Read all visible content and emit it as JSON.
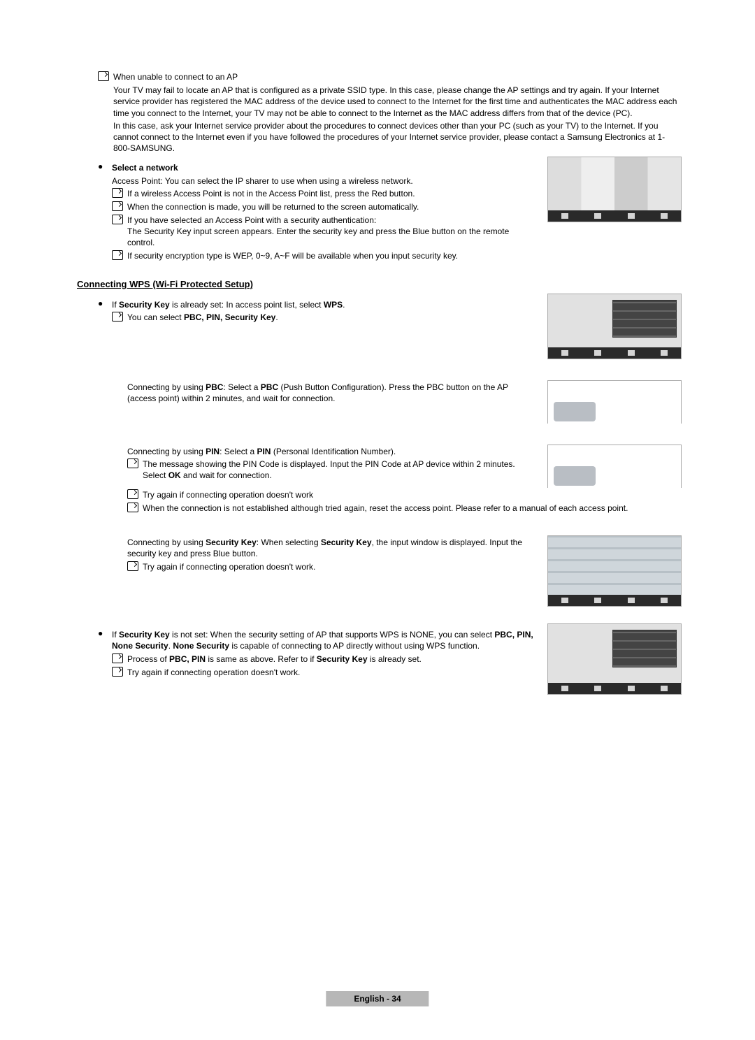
{
  "s1": {
    "n1": "When unable to connect to an AP",
    "p1": "Your TV may fail to locate an AP that is configured as a private SSID type. In this case, please change the AP settings and try again. If your Internet service provider has registered the MAC address of the device used to connect to the Internet for the first time and authenticates the MAC address each time you connect to the Internet, your TV may not be able to connect to the Internet as the MAC address differs from that of the device (PC).",
    "p2": "In this case, ask your Internet service provider about the procedures to connect devices other than your PC (such as your TV) to the Internet. If you cannot connect to the Internet even if you have followed the procedures of your Internet service provider, please contact a Samsung Electronics at 1-800-SAMSUNG."
  },
  "s2": {
    "title": "Select a network",
    "p1": "Access Point: You can select the IP sharer to use when using a wireless network.",
    "n1": "If a wireless Access Point is not in the Access Point list, press the Red button.",
    "n2": "When the connection is made, you will be returned to the screen automatically.",
    "n3a": "If you have selected an Access Point with a security authentication:",
    "n3b": "The Security Key input screen appears. Enter the security key and press the Blue button on the remote control.",
    "n4": "If security encryption type is WEP, 0~9, A~F will be available when you input security key."
  },
  "heading": "Connecting WPS (Wi-Fi Protected Setup)",
  "wps1": {
    "b1a": "If ",
    "b1b": "Security Key",
    "b1c": " is already set: In access point list, select ",
    "b1d": "WPS",
    "b1e": ".",
    "n1a": "You can select ",
    "n1b": "PBC, PIN, Security Key",
    "n1c": "."
  },
  "pbc": {
    "t1": "Connecting by using ",
    "t2": "PBC",
    "t3": ": Select a ",
    "t4": "PBC",
    "t5": " (Push Button Configuration). Press the PBC button on the AP (access point) within 2 minutes, and wait for connection."
  },
  "pin": {
    "t1": "Connecting by using ",
    "t2": "PIN",
    "t3": ": Select a ",
    "t4": "PIN",
    "t5": " (Personal Identification Number).",
    "n1a": "The message showing the PIN Code is displayed. Input the PIN Code at AP device within 2 minutes. Select ",
    "n1b": "OK",
    "n1c": " and wait for connection.",
    "n2": "Try again if connecting operation doesn't work",
    "n3": "When the connection is not established although tried again, reset the access point. Please refer to a manual of each access point."
  },
  "sk": {
    "t1": "Connecting by using ",
    "t2": "Security Key",
    "t3": ": When selecting ",
    "t4": "Security Key",
    "t5": ", the input window is displayed. Input the security key and press Blue button.",
    "n1": "Try again if connecting operation doesn't work."
  },
  "nset": {
    "t1": "If ",
    "t2": "Security Key",
    "t3": " is not set: When the security setting of AP that supports WPS is NONE, you can select ",
    "t4": "PBC, PIN, None Security",
    "t5": ". ",
    "t6": "None Security",
    "t7": " is capable of connecting to AP directly without using WPS function.",
    "n1a": "Process of ",
    "n1b": "PBC, PIN",
    "n1c": " is same as above. Refer to if ",
    "n1d": "Security Key",
    "n1e": " is already set.",
    "n2": "Try again if connecting operation doesn't work."
  },
  "footer": "English - 34"
}
